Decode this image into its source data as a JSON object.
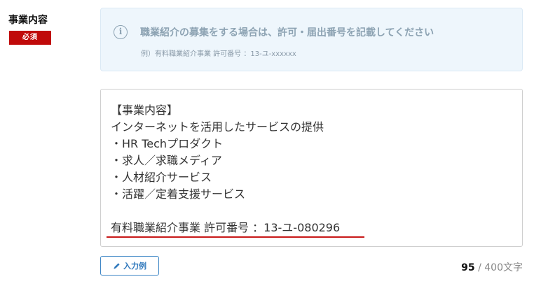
{
  "field": {
    "label": "事業内容",
    "required_badge": "必須"
  },
  "notice": {
    "icon": "info-circle-icon",
    "icon_glyph": "i",
    "title": "職業紹介の募集をする場合は、許可・届出番号を記載してください",
    "example": "例）有料職業紹介事業 許可番号 ：13-ユ-xxxxxx"
  },
  "textarea": {
    "lines": [
      "【事業内容】",
      "インターネットを活用したサービスの提供",
      "・HR Techプロダクト",
      "・求人／求職メディア",
      "・人材紹介サービス",
      "・活躍／定着支援サービス",
      "",
      "有料職業紹介事業 許可番号 ：13-ユ-080296"
    ]
  },
  "example_button": {
    "icon": "pencil-icon",
    "label": "入力例"
  },
  "counter": {
    "current": "95",
    "separator": " / ",
    "max": "400文字"
  },
  "colors": {
    "required_badge": "#c00a0a",
    "notice_bg": "#eef6fc",
    "notice_text": "#8da3b3",
    "accent_blue": "#2f78bc",
    "highlight_underline": "#c81818"
  }
}
